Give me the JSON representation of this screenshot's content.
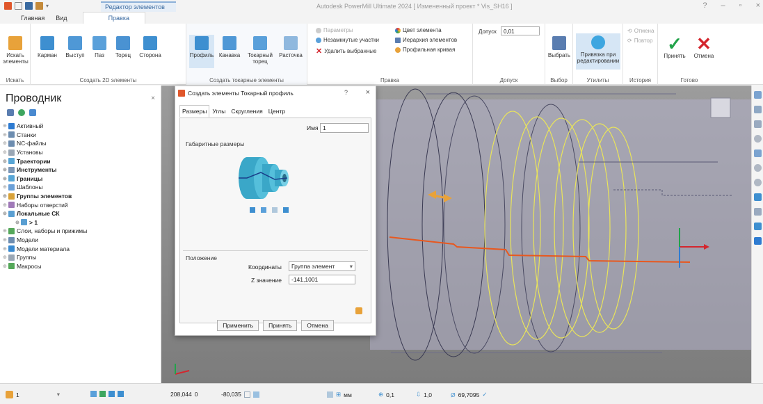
{
  "titlebar": {
    "context_tab": "Редактор элементов",
    "window_title": "Autodesk PowerMill Ultimate 2024   [ Измененный проект * Vis_SH16 ]",
    "help": "?",
    "minimize": "–",
    "restore": "▫",
    "close": "×"
  },
  "ribbon": {
    "tabs": [
      "Главная",
      "Вид",
      "Правка"
    ],
    "groups": {
      "search": {
        "label": "Искать",
        "btn": "Искать\nэлементы"
      },
      "create2d": {
        "label": "Создать 2D элементы",
        "buttons": [
          "Карман",
          "Выступ",
          "Паз",
          "Торец",
          "Сторона"
        ]
      },
      "turning": {
        "label": "Создать токарные элементы",
        "buttons": [
          "Профиль",
          "Канавка",
          "Токарный\nторец",
          "Расточка"
        ]
      },
      "edit": {
        "label": "Правка",
        "items": [
          "Параметры",
          "Незамкнутые участки",
          "Удалить выбранные",
          "Цвет элемента",
          "Иерархия элементов",
          "Профильная кривая"
        ]
      },
      "tolerance": {
        "label": "Допуск",
        "field_label": "Допуск",
        "field_value": "0,01"
      },
      "select": {
        "label": "Выбор",
        "btn": "Выбрать"
      },
      "utils": {
        "label": "Утилиты",
        "btn": "Привязка при\nредактировании"
      },
      "history": {
        "label": "История",
        "items": [
          "Отмена",
          "Повтор"
        ]
      },
      "done": {
        "label": "Готово",
        "buttons": [
          "Принять",
          "Отмена"
        ]
      }
    }
  },
  "explorer": {
    "title": "Проводник",
    "close": "×",
    "items": [
      {
        "label": "Активный",
        "bold": false,
        "indent": 0,
        "color": "#2e7bd1"
      },
      {
        "label": "Станки",
        "bold": false,
        "indent": 0,
        "color": "#6d8db0"
      },
      {
        "label": "NC-файлы",
        "bold": false,
        "indent": 0,
        "color": "#6d8db0"
      },
      {
        "label": "Установы",
        "bold": false,
        "indent": 0,
        "color": "#9aa7b5"
      },
      {
        "label": "Траектории",
        "bold": true,
        "indent": 0,
        "color": "#58a6d6"
      },
      {
        "label": "Инструменты",
        "bold": true,
        "indent": 0,
        "color": "#7c97b6"
      },
      {
        "label": "Границы",
        "bold": true,
        "indent": 0,
        "color": "#58a6d6"
      },
      {
        "label": "Шаблоны",
        "bold": false,
        "indent": 0,
        "color": "#6aa0d8"
      },
      {
        "label": "Группы элементов",
        "bold": true,
        "indent": 0,
        "color": "#d8a23a"
      },
      {
        "label": "Наборы отверстий",
        "bold": false,
        "indent": 0,
        "color": "#a07ab8"
      },
      {
        "label": "Локальные СК",
        "bold": true,
        "indent": 0,
        "color": "#5a9fd2"
      },
      {
        "label": "> 1",
        "bold": true,
        "indent": 1,
        "color": "#5a9fd2"
      },
      {
        "label": "Слои, наборы и прижимы",
        "bold": false,
        "indent": 0,
        "color": "#55a85a"
      },
      {
        "label": "Модели",
        "bold": false,
        "indent": 0,
        "color": "#6d8db0"
      },
      {
        "label": "Модели материала",
        "bold": false,
        "indent": 0,
        "color": "#3a8ad0"
      },
      {
        "label": "Группы",
        "bold": false,
        "indent": 0,
        "color": "#9aa7b5"
      },
      {
        "label": "Макросы",
        "bold": false,
        "indent": 0,
        "color": "#55a85a"
      }
    ]
  },
  "dialog": {
    "title": "Создать элементы Токарный профиль",
    "help": "?",
    "close": "×",
    "tabs": [
      "Размеры",
      "Углы",
      "Скругления",
      "Центр"
    ],
    "name_label": "Имя",
    "name_value": "1",
    "dims_section": "Габаритные размеры",
    "position_section": "Положение",
    "coords_label": "Координаты",
    "coords_value": "Группа элемент",
    "z_label": "Z значение",
    "z_value": "-141,1001",
    "buttons": [
      "Применить",
      "Принять",
      "Отмена"
    ]
  },
  "status": {
    "layer": "1",
    "x_value": "208,044",
    "y_value": "0",
    "z_value": "-80,035",
    "units": "мм",
    "tolerance": "0,1",
    "step": "1,0",
    "diameter": "69,7095"
  },
  "colors": {
    "accent": "#3a6aa0",
    "profile_line": "#e8581f",
    "yellow_curves": "#e9e45a",
    "accept_green": "#22a34a",
    "cancel_red": "#d4262e"
  }
}
